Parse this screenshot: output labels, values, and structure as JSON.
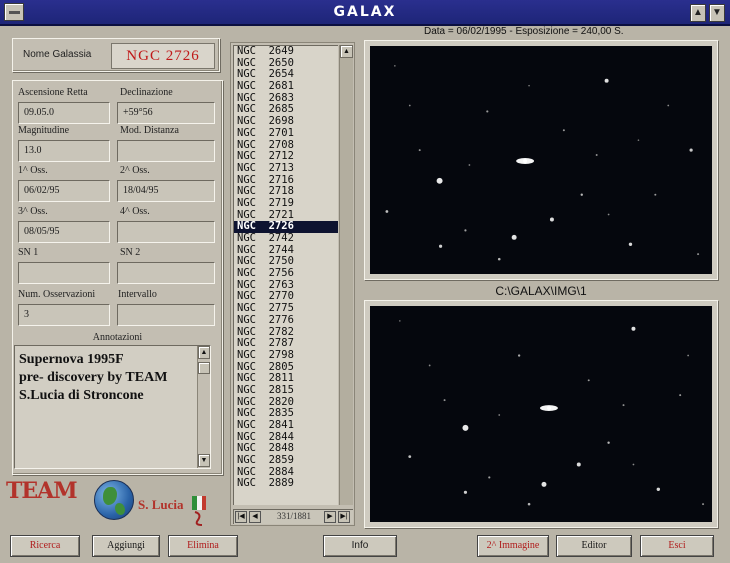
{
  "window": {
    "title": "GALAX",
    "minimize_glyph": "▲",
    "maximize_glyph": "▼"
  },
  "galaxy": {
    "name_label": "Nome Galassia",
    "name": "NGC  2726"
  },
  "fields": [
    {
      "label": "Ascensione Retta",
      "value": "09.05.0"
    },
    {
      "label": "Declinazione",
      "value": "+59°56"
    },
    {
      "label": "Magnitudine",
      "value": "13.0"
    },
    {
      "label": "Mod. Distanza",
      "value": ""
    },
    {
      "label": "1^ Oss.",
      "value": "06/02/95"
    },
    {
      "label": "2^ Oss.",
      "value": "18/04/95"
    },
    {
      "label": "3^ Oss.",
      "value": "08/05/95"
    },
    {
      "label": "4^ Oss.",
      "value": ""
    },
    {
      "label": "SN 1",
      "value": ""
    },
    {
      "label": "SN 2",
      "value": ""
    },
    {
      "label": "Num. Osservazioni",
      "value": "3"
    },
    {
      "label": "Intervallo",
      "value": ""
    }
  ],
  "notes": {
    "label": "Annotazioni",
    "lines": [
      "Supernova 1995F",
      "pre- discovery by TEAM",
      "S.Lucia di Stroncone"
    ]
  },
  "logo": {
    "text": "TEAM",
    "place": "S. Lucia"
  },
  "list": {
    "items": [
      "NGC  2649",
      "NGC  2650",
      "NGC  2654",
      "NGC  2681",
      "NGC  2683",
      "NGC  2685",
      "NGC  2698",
      "NGC  2701",
      "NGC  2708",
      "NGC  2712",
      "NGC  2713",
      "NGC  2716",
      "NGC  2718",
      "NGC  2719",
      "NGC  2721",
      "NGC  2726",
      "NGC  2742",
      "NGC  2744",
      "NGC  2750",
      "NGC  2756",
      "NGC  2763",
      "NGC  2770",
      "NGC  2775",
      "NGC  2776",
      "NGC  2782",
      "NGC  2787",
      "NGC  2798",
      "NGC  2805",
      "NGC  2811",
      "NGC  2815",
      "NGC  2820",
      "NGC  2835",
      "NGC  2841",
      "NGC  2844",
      "NGC  2848",
      "NGC  2859",
      "NGC  2884",
      "NGC  2889"
    ],
    "selected_index": 15,
    "record_counter": "331/1881"
  },
  "image_info": {
    "date_exposure": "Data = 06/02/1995 - Esposizione = 240,00 S.",
    "path": "C:\\GALAX\\IMG\\1"
  },
  "buttons": {
    "search": "Ricerca",
    "add": "Aggiungi",
    "delete": "Elimina",
    "info": "Info",
    "second_image": "2^ Immagine",
    "editor": "Editor",
    "exit": "Esci"
  }
}
